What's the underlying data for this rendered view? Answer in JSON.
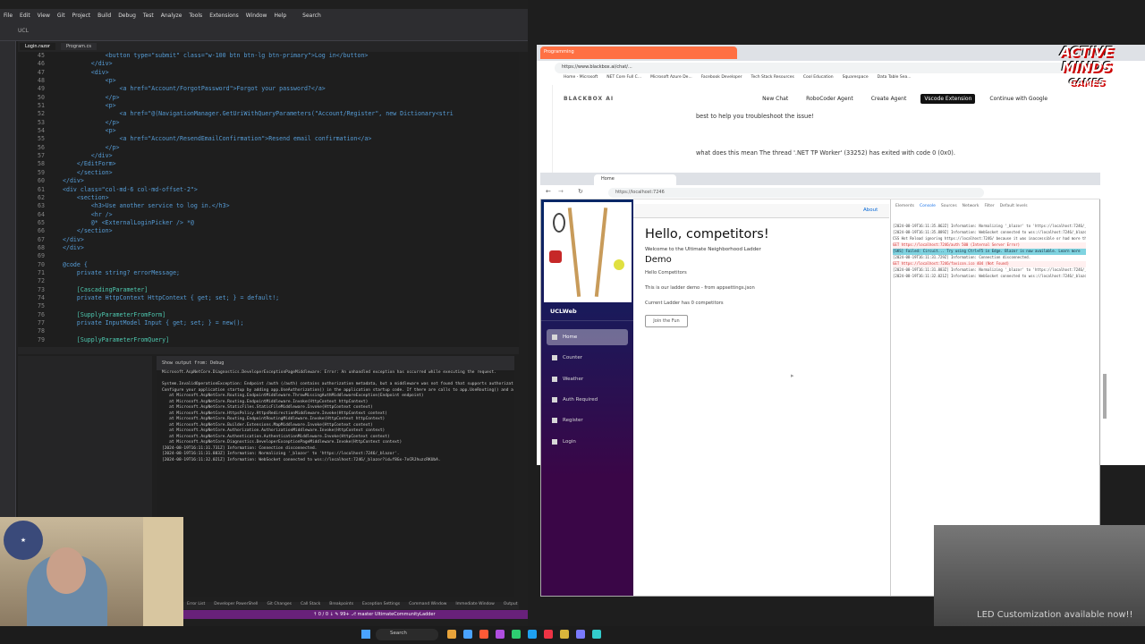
{
  "ide": {
    "menu": [
      "File",
      "Edit",
      "View",
      "Git",
      "Project",
      "Build",
      "Debug",
      "Test",
      "Analyze",
      "Tools",
      "Extensions",
      "Window",
      "Help"
    ],
    "search": "Search",
    "solution": "UCL",
    "tabs": [
      "Login.razor",
      "Program.cs"
    ],
    "code": [
      {
        "n": "45",
        "t": "            <button type=\"submit\" class=\"w-100 btn btn-lg btn-primary\">Log in</button>"
      },
      {
        "n": "46",
        "t": "        </div>"
      },
      {
        "n": "47",
        "t": "        <div>"
      },
      {
        "n": "48",
        "t": "            <p>"
      },
      {
        "n": "49",
        "t": "                <a href=\"Account/ForgotPassword\">Forgot your password?</a>"
      },
      {
        "n": "50",
        "t": "            </p>"
      },
      {
        "n": "51",
        "t": "            <p>"
      },
      {
        "n": "52",
        "t": "                <a href=\"@(NavigationManager.GetUriWithQueryParameters(\"Account/Register\", new Dictionary<stri"
      },
      {
        "n": "53",
        "t": "            </p>"
      },
      {
        "n": "54",
        "t": "            <p>"
      },
      {
        "n": "55",
        "t": "                <a href=\"Account/ResendEmailConfirmation\">Resend email confirmation</a>"
      },
      {
        "n": "56",
        "t": "            </p>"
      },
      {
        "n": "57",
        "t": "        </div>"
      },
      {
        "n": "58",
        "t": "    </EditForm>"
      },
      {
        "n": "59",
        "t": "    </section>"
      },
      {
        "n": "60",
        "t": "</div>"
      },
      {
        "n": "61",
        "t": "<div class=\"col-md-6 col-md-offset-2\">"
      },
      {
        "n": "62",
        "t": "    <section>"
      },
      {
        "n": "63",
        "t": "        <h3>Use another service to log in.</h3>"
      },
      {
        "n": "64",
        "t": "        <hr />"
      },
      {
        "n": "65",
        "t": "        @* <ExternalLoginPicker /> *@"
      },
      {
        "n": "66",
        "t": "    </section>"
      },
      {
        "n": "67",
        "t": "</div>"
      },
      {
        "n": "68",
        "t": "</div>"
      },
      {
        "n": "69",
        "t": ""
      },
      {
        "n": "70",
        "t": "@code {"
      },
      {
        "n": "71",
        "t": "    private string? errorMessage;"
      },
      {
        "n": "72",
        "t": ""
      },
      {
        "n": "73",
        "t": "    [CascadingParameter]"
      },
      {
        "n": "74",
        "t": "    private HttpContext HttpContext { get; set; } = default!;"
      },
      {
        "n": "75",
        "t": ""
      },
      {
        "n": "76",
        "t": "    [SupplyParameterFromForm]"
      },
      {
        "n": "77",
        "t": "    private InputModel Input { get; set; } = new();"
      },
      {
        "n": "78",
        "t": ""
      },
      {
        "n": "79",
        "t": "    [SupplyParameterFromQuery]"
      }
    ],
    "output_header": "Show output from: Debug",
    "output": [
      "Microsoft.AspNetCore.Diagnostics.DeveloperExceptionPageMiddleware: Error: An unhandled exception has occurred while executing the request.",
      "",
      "System.InvalidOperationException: Endpoint /auth (/auth) contains authorization metadata, but a middleware was not found that supports authorizat",
      "Configure your application startup by adding app.UseAuthorization() in the application startup code. If there are calls to app.UseRouting() and a",
      "   at Microsoft.AspNetCore.Routing.EndpointMiddleware.ThrowMissingAuthMiddlewareException(Endpoint endpoint)",
      "   at Microsoft.AspNetCore.Routing.EndpointMiddleware.Invoke(HttpContext httpContext)",
      "   at Microsoft.AspNetCore.StaticFiles.StaticFileMiddleware.Invoke(HttpContext context)",
      "   at Microsoft.AspNetCore.HttpsPolicy.HttpsRedirectionMiddleware.Invoke(HttpContext context)",
      "   at Microsoft.AspNetCore.Routing.EndpointRoutingMiddleware.Invoke(HttpContext httpContext)",
      "   at Microsoft.AspNetCore.Builder.Extensions.MapMiddleware.Invoke(HttpContext context)",
      "   at Microsoft.AspNetCore.Authorization.AuthorizationMiddleware.Invoke(HttpContext context)",
      "   at Microsoft.AspNetCore.Authentication.AuthenticationMiddleware.Invoke(HttpContext context)",
      "   at Microsoft.AspNetCore.Diagnostics.DeveloperExceptionPageMiddleware.Invoke(HttpContext context)",
      "[2024-08-19T16:11:31.731Z] Information: Connection disconnected.",
      "[2024-08-19T16:11:31.883Z] Information: Normalizing '_blazor' to 'https://localhost:7246/_blazor'.",
      "[2024-08-19T16:11:32.021Z] Information: WebSocket connected to wss://localhost:7246/_blazor?id=f8Gx-7oCRJhuzcRKUbA."
    ],
    "bottom_tabs": [
      "Error List",
      "Developer PowerShell",
      "Git Changes",
      "Call Stack",
      "Breakpoints",
      "Exception Settings",
      "Command Window",
      "Immediate Window",
      "Output"
    ],
    "status": "↑ 0 / 0 ↓  ✎ 99+  ⎇ master  UltimateCommunityLadder"
  },
  "bg_browser": {
    "tab": "Programming",
    "address": "https://www.blackbox.ai/chat/...",
    "bookmarks": [
      "Home - Microsoft",
      "NET Core Full C...",
      "Microsoft Azure De...",
      "Facebook Developer",
      "Tech Stack Resources",
      "Cool Education",
      "Squarespace",
      "Data Table Sea..."
    ],
    "logo": "BLACKBOX AI",
    "new_chat": "New Chat",
    "robocoder": "RoboCoder Agent",
    "create_agent": "Create Agent",
    "vscode_ext": "Vscode Extension",
    "continue_google": "Continue with Google",
    "msg1": "best to help you troubleshoot the issue!",
    "msg2": "what does this mean The thread '.NET TP Worker' (33252) has exited with code 0 (0x0)."
  },
  "brand": {
    "line1": "ACTIVE",
    "line2": "MINDS",
    "line3": "GAMES"
  },
  "app": {
    "tab_title": "Home",
    "address": "https://localhost:7246",
    "brand": "UCLWeb",
    "nav": [
      {
        "label": "Home",
        "icon": "home-icon"
      },
      {
        "label": "Counter",
        "icon": "plus-icon"
      },
      {
        "label": "Weather",
        "icon": "list-icon"
      },
      {
        "label": "Auth Required",
        "icon": "lock-icon"
      },
      {
        "label": "Register",
        "icon": "person-icon"
      },
      {
        "label": "Login",
        "icon": "login-icon"
      }
    ],
    "about": "About",
    "h1": "Hello, competitors!",
    "subtitle": "Welcome to the Ultimate Neighborhood Ladder",
    "h2": "Demo",
    "p1": "Hello Competitors",
    "p2": "This is our ladder demo - from appsettings.json",
    "p3": "Current Ladder has 0 competitors",
    "join": "Join the Fun"
  },
  "devtools": {
    "tabs": [
      "Elements",
      "Console",
      "Sources",
      "Network"
    ],
    "filter": "Filter",
    "levels": "Default levels",
    "lines": [
      {
        "t": "[2024-08-19T16:11:35.862Z] Information: Normalizing '_blazor' to 'https://localhost:7246/_blazor'.",
        "c": ""
      },
      {
        "t": "[2024-08-19T16:11:35.889Z] Information: WebSocket connected to wss://localhost:7246/_blazor?id=...",
        "c": ""
      },
      {
        "t": "CSS Hot Reload ignoring https://localhost:7246/ because it was inaccessible or had more than 7000 rules.",
        "c": ""
      },
      {
        "t": "GET https://localhost:7246/auth 500 (Internal Server Error)",
        "c": "err"
      },
      {
        "t": "[SKS] Failed: Circuit... Try using Ctrl+F5 in Edge. Blazor is now available. Learn more",
        "c": "hl"
      },
      {
        "t": "[2024-08-19T16:11:31.729Z] Information: Connection disconnected.",
        "c": ""
      },
      {
        "t": "GET https://localhost:7246/favicon.ico 404 (Not Found)",
        "c": "err"
      },
      {
        "t": "[2024-08-19T16:11:31.883Z] Information: Normalizing '_blazor' to 'https://localhost:7246/_blazor'.",
        "c": ""
      },
      {
        "t": "[2024-08-19T16:11:32.021Z] Information: WebSocket connected to wss://localhost:7246/_blazor?id=f8Gx...",
        "c": ""
      }
    ]
  },
  "overlay": {
    "led": "LED Customization available now!!"
  },
  "taskbar": {
    "search": "Search"
  }
}
